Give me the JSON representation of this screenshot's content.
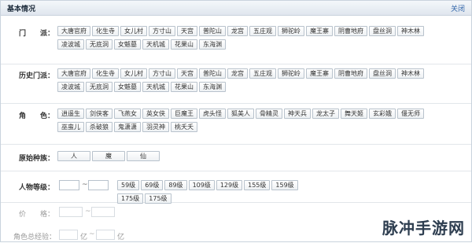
{
  "window": {
    "title": "基本情况",
    "close_label": "关闭"
  },
  "sections": {
    "sect": {
      "label": "门　　派：",
      "options": [
        "大唐官府",
        "化生寺",
        "女儿村",
        "方寸山",
        "天宫",
        "普陀山",
        "龙宫",
        "五庄观",
        "狮驼岭",
        "魔王寨",
        "阴曹地府",
        "盘丝洞",
        "神木林",
        "凌波城",
        "无底洞",
        "女魃墓",
        "天机城",
        "花果山",
        "东海渊"
      ]
    },
    "history_sect": {
      "label": "历史门派：",
      "options": [
        "大唐官府",
        "化生寺",
        "女儿村",
        "方寸山",
        "天宫",
        "普陀山",
        "龙宫",
        "五庄观",
        "狮驼岭",
        "魔王寨",
        "阴曹地府",
        "盘丝洞",
        "神木林",
        "凌波城",
        "无底洞",
        "女魃墓",
        "天机城",
        "花果山",
        "东海渊"
      ]
    },
    "role": {
      "label": "角　　色：",
      "options": [
        "逍遥生",
        "剑侠客",
        "飞燕女",
        "英女侠",
        "巨魔王",
        "虎头怪",
        "狐美人",
        "骨精灵",
        "神天兵",
        "龙太子",
        "舞天姬",
        "玄彩娥",
        "偃无师",
        "巫蛮儿",
        "杀破狼",
        "鬼潇潇",
        "羽灵神",
        "桃夭夭"
      ]
    },
    "race": {
      "label": "原始种族：",
      "options": [
        "人",
        "魔",
        "仙"
      ]
    },
    "level": {
      "label": "人物等级：",
      "dash": "~",
      "options": [
        "59级",
        "69级",
        "89级",
        "109级",
        "129级",
        "155级",
        "159级",
        "175级",
        "175级"
      ]
    },
    "price": {
      "label": "价　　格：",
      "dash": "~"
    },
    "exp": {
      "label": "角色总经验：",
      "dash": "~",
      "unit": "亿"
    }
  },
  "watermark": "脉冲手游网"
}
